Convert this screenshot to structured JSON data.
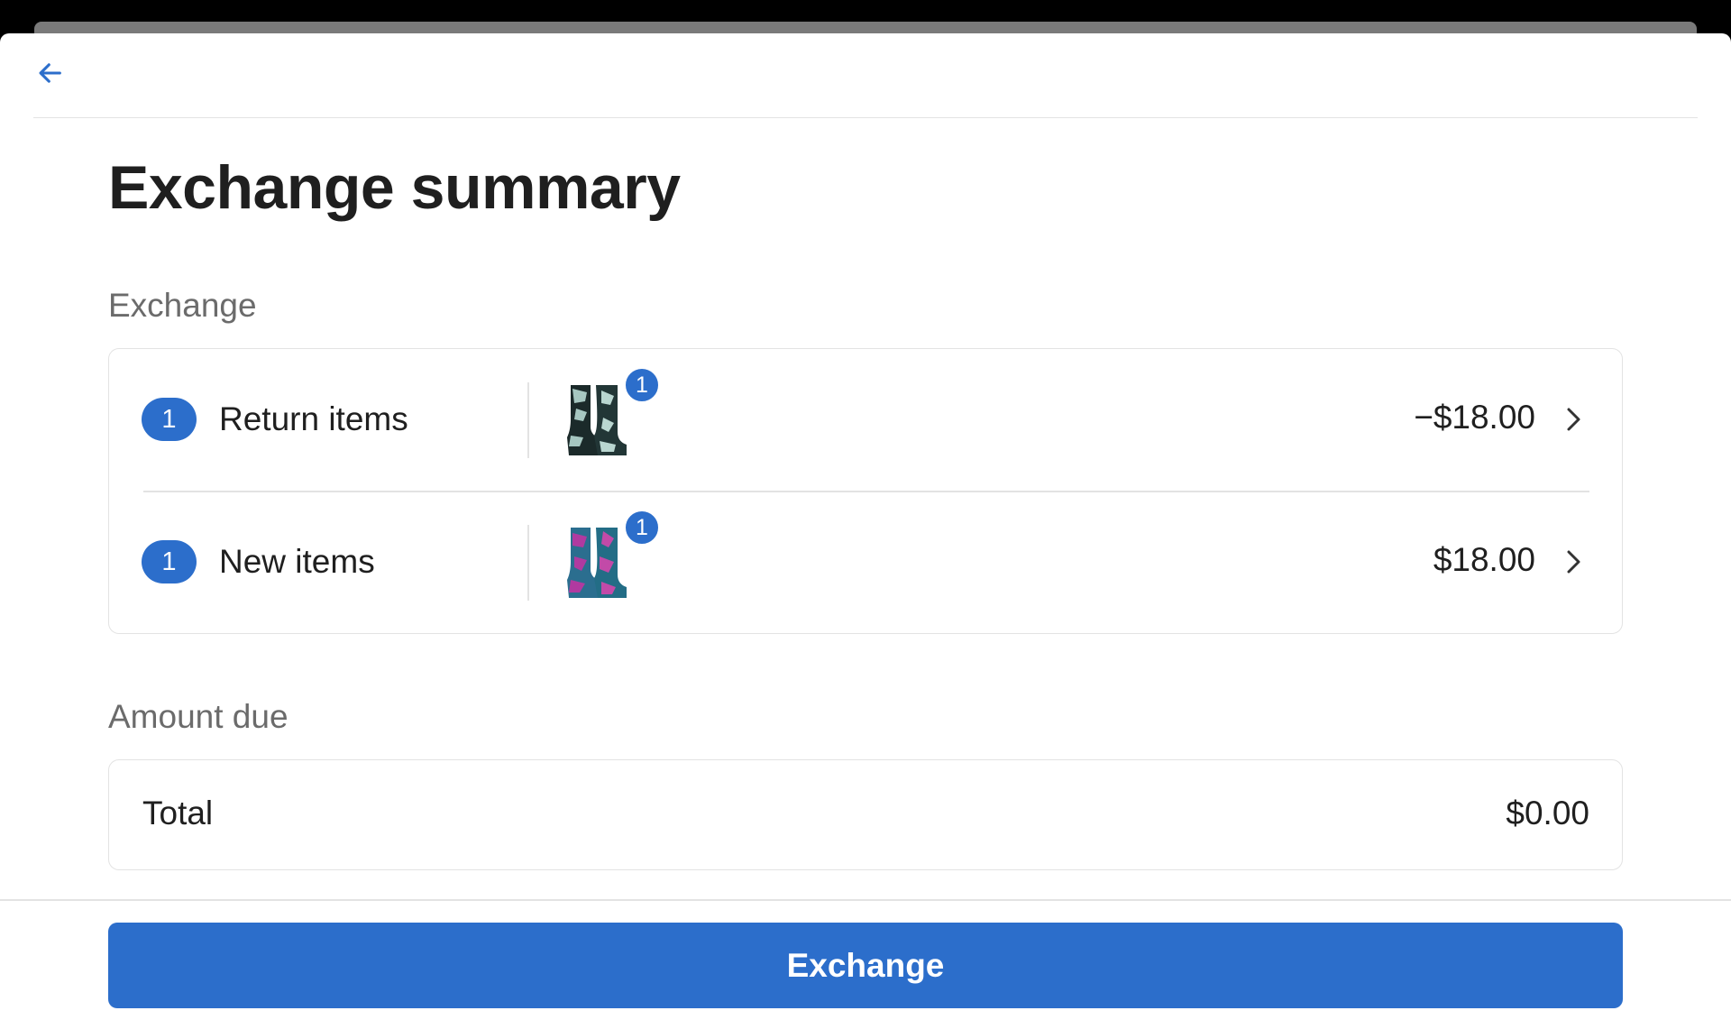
{
  "header": {
    "back_icon": "arrow-left-icon"
  },
  "page_title": "Exchange summary",
  "exchange_section": {
    "label": "Exchange",
    "rows": [
      {
        "count": "1",
        "label": "Return items",
        "thumb_badge": "1",
        "amount": "−$18.00",
        "chevron_icon": "chevron-right-icon",
        "thumb_colors": [
          "#1b2a2a",
          "#a6c7c1"
        ]
      },
      {
        "count": "1",
        "label": "New items",
        "thumb_badge": "1",
        "amount": "$18.00",
        "chevron_icon": "chevron-right-icon",
        "thumb_colors": [
          "#2b6e8f",
          "#b03aa0"
        ]
      }
    ]
  },
  "amount_due_section": {
    "label": "Amount due",
    "total_label": "Total",
    "total_amount": "$0.00"
  },
  "footer": {
    "exchange_button_label": "Exchange"
  },
  "colors": {
    "accent": "#2c6ecb",
    "border": "#e3e3e3",
    "muted_text": "#6b6b6b"
  }
}
